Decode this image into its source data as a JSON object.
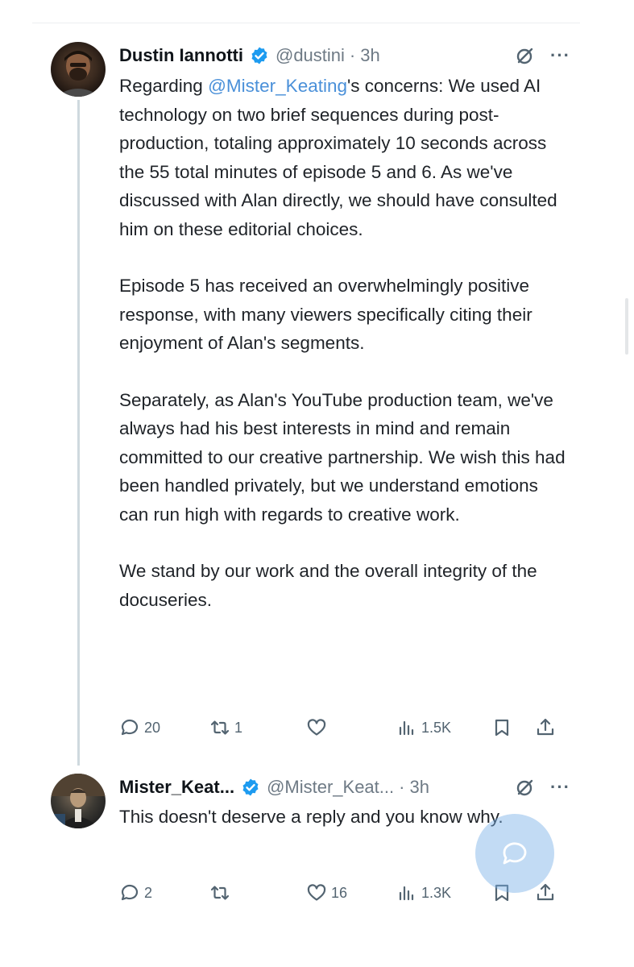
{
  "tweets": [
    {
      "author": {
        "display_name": "Dustin Iannotti",
        "verified": true,
        "handle": "@dustini",
        "time": "3h",
        "avatar_icon": "avatar-photo"
      },
      "text": {
        "p1_prefix": "Regarding ",
        "p1_mention": "@Mister_Keating",
        "p1_suffix": "'s concerns: We used AI technology on two brief sequences during post-production, totaling approximately 10 seconds across the 55 total minutes of episode 5 and 6. As we've discussed with Alan directly, we should have consulted him on these editorial choices.",
        "p2": "Episode 5 has received an overwhelmingly positive response, with many viewers specifically citing their enjoyment of Alan's segments.",
        "p3": "Separately, as Alan's YouTube production team, we've always had his best interests in mind and remain committed to our creative partnership. We wish this had been handled privately, but we understand emotions can run high with regards to creative work.",
        "p4": "We stand by our work and the overall integrity of the docuseries."
      },
      "actions": {
        "reply_count": "20",
        "retweet_count": "1",
        "like_count": "",
        "views_count": "1.5K"
      }
    },
    {
      "author": {
        "display_name": "Mister_Keat...",
        "verified": true,
        "handle": "@Mister_Keat...",
        "time": "3h",
        "avatar_icon": "avatar-photo"
      },
      "text": {
        "p1": "This doesn't deserve a reply and you know why."
      },
      "actions": {
        "reply_count": "2",
        "retweet_count": "",
        "like_count": "16",
        "views_count": "1.3K"
      }
    }
  ],
  "header_separator": "·",
  "more_label": "···",
  "icons": {
    "verified": "verified-badge-icon",
    "grok": "grok-icon",
    "more": "more-icon",
    "reply": "reply-icon",
    "retweet": "retweet-icon",
    "like": "like-icon",
    "views": "views-icon",
    "bookmark": "bookmark-icon",
    "share": "share-icon",
    "compose": "compose-reply-icon"
  },
  "colors": {
    "accent": "#1d9bf0",
    "mention": "#4a90d9",
    "muted": "#6e7a85",
    "fab": "#78afe6"
  }
}
